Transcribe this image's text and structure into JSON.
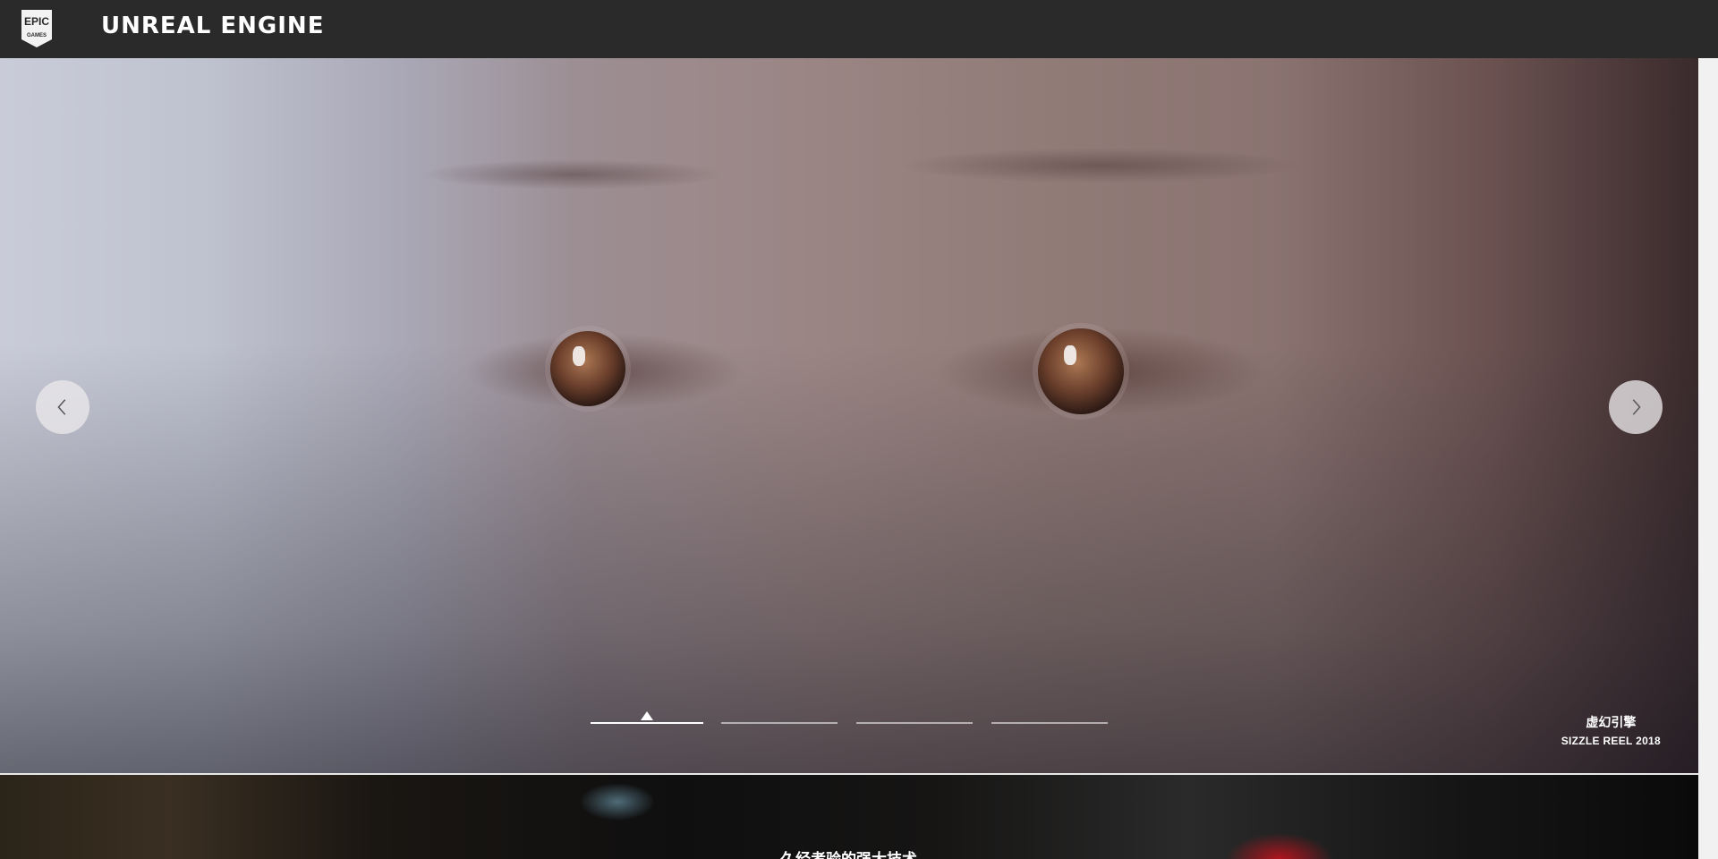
{
  "header": {
    "logo_text_top": "EPIC",
    "logo_text_bottom": "GAMES",
    "brand_title": "UNREAL ENGINE"
  },
  "hero": {
    "prev_icon": "chevron-left-icon",
    "next_icon": "chevron-right-icon",
    "slides": [
      {
        "active": true
      },
      {
        "active": false
      },
      {
        "active": false
      },
      {
        "active": false
      }
    ],
    "caption": {
      "line1": "虚幻引擎",
      "line2": "SIZZLE REEL 2018"
    }
  },
  "section_two": {
    "title": "久经考验的强大技术"
  }
}
